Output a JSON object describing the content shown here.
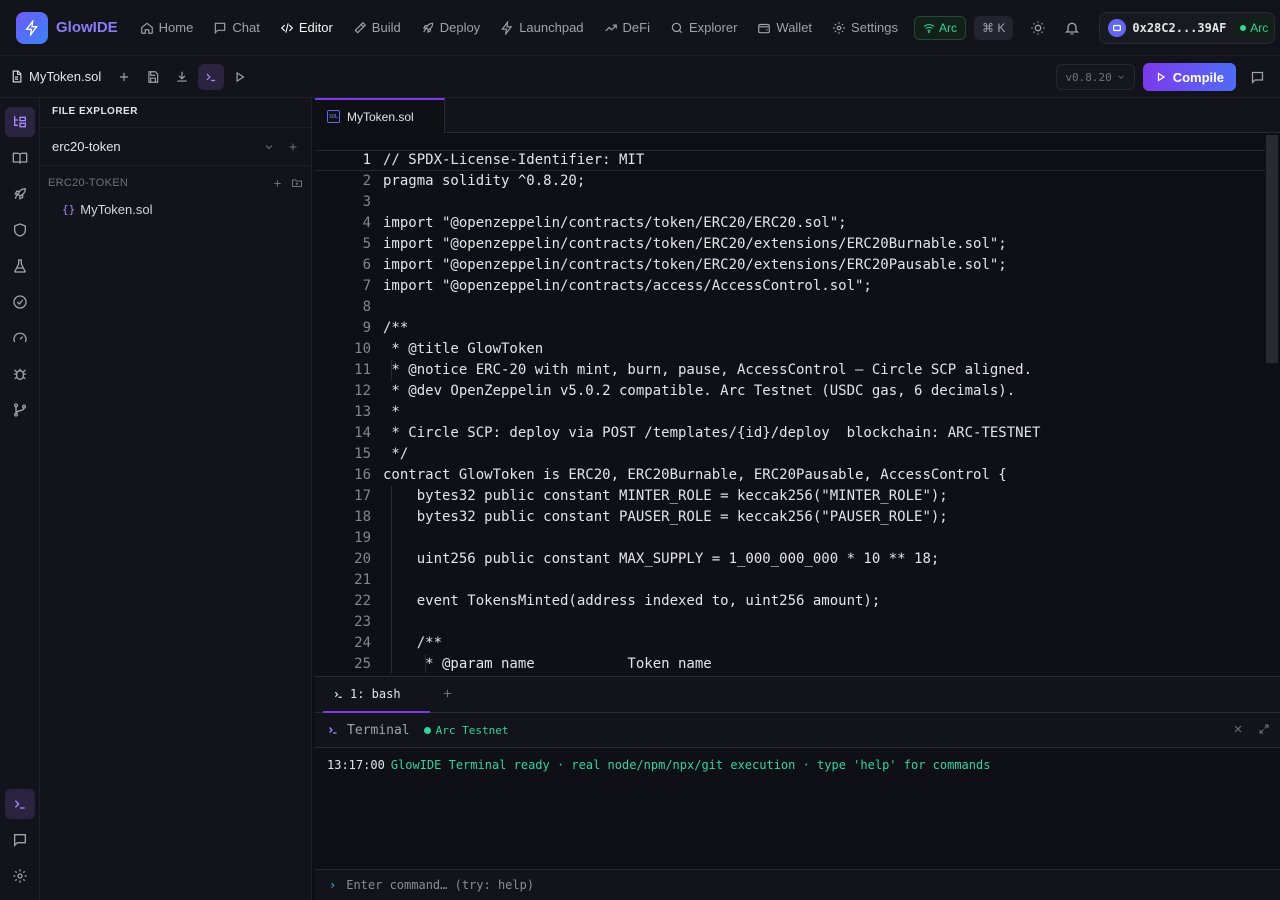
{
  "app": {
    "name": "GlowIDE"
  },
  "nav": {
    "items": [
      {
        "label": "Home",
        "icon": "home-icon"
      },
      {
        "label": "Chat",
        "icon": "chat-icon"
      },
      {
        "label": "Editor",
        "icon": "code-icon",
        "active": true
      },
      {
        "label": "Build",
        "icon": "hammer-icon"
      },
      {
        "label": "Deploy",
        "icon": "rocket-icon"
      },
      {
        "label": "Launchpad",
        "icon": "zap-icon"
      },
      {
        "label": "DeFi",
        "icon": "trend-icon"
      },
      {
        "label": "Explorer",
        "icon": "search-icon"
      },
      {
        "label": "Wallet",
        "icon": "wallet-icon"
      },
      {
        "label": "Settings",
        "icon": "gear-icon"
      }
    ],
    "network_badge": "Arc",
    "shortcut": "⌘ K",
    "wallet_address": "0x28C2...39AF",
    "wallet_network": "Arc"
  },
  "toolbar": {
    "file_name": "MyToken.sol",
    "compiler_version": "v0.8.20",
    "compile_label": "Compile"
  },
  "explorer": {
    "title": "FILE EXPLORER",
    "workspace": "erc20-token",
    "project": "ERC20-TOKEN",
    "files": [
      {
        "name": "MyToken.sol",
        "icon": "{}"
      }
    ]
  },
  "editor": {
    "tab": "MyToken.sol",
    "tab_icon_text": "SOL",
    "current_line": 1,
    "lines": [
      "// SPDX-License-Identifier: MIT",
      "pragma solidity ^0.8.20;",
      "",
      "import \"@openzeppelin/contracts/token/ERC20/ERC20.sol\";",
      "import \"@openzeppelin/contracts/token/ERC20/extensions/ERC20Burnable.sol\";",
      "import \"@openzeppelin/contracts/token/ERC20/extensions/ERC20Pausable.sol\";",
      "import \"@openzeppelin/contracts/access/AccessControl.sol\";",
      "",
      "/**",
      " * @title GlowToken",
      " * @notice ERC-20 with mint, burn, pause, AccessControl — Circle SCP aligned.",
      " * @dev OpenZeppelin v5.0.2 compatible. Arc Testnet (USDC gas, 6 decimals).",
      " *",
      " * Circle SCP: deploy via POST /templates/{id}/deploy  blockchain: ARC-TESTNET",
      " */",
      "contract GlowToken is ERC20, ERC20Burnable, ERC20Pausable, AccessControl {",
      "    bytes32 public constant MINTER_ROLE = keccak256(\"MINTER_ROLE\");",
      "    bytes32 public constant PAUSER_ROLE = keccak256(\"PAUSER_ROLE\");",
      "",
      "    uint256 public constant MAX_SUPPLY = 1_000_000_000 * 10 ** 18;",
      "",
      "    event TokensMinted(address indexed to, uint256 amount);",
      "",
      "    /**",
      "     * @param name           Token name"
    ]
  },
  "terminal": {
    "tab_label": "1: bash",
    "title": "Terminal",
    "network": "Arc Testnet",
    "log": [
      {
        "time": "13:17:00",
        "message": "GlowIDE Terminal ready · real node/npm/npx/git execution · type 'help' for commands"
      }
    ],
    "input_placeholder": "Enter command… (try: help)"
  }
}
